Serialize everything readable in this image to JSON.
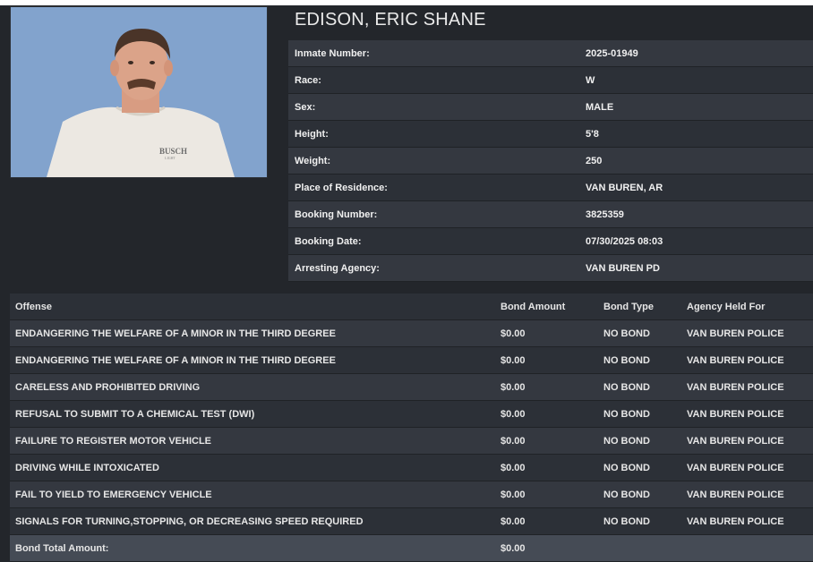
{
  "inmate": {
    "name": "EDISON, ERIC SHANE",
    "fields": [
      {
        "label": "Inmate Number:",
        "value": "2025-01949"
      },
      {
        "label": "Race:",
        "value": "W"
      },
      {
        "label": "Sex:",
        "value": "MALE"
      },
      {
        "label": "Height:",
        "value": "5'8"
      },
      {
        "label": "Weight:",
        "value": "250"
      },
      {
        "label": "Place of Residence:",
        "value": "VAN BUREN, AR"
      },
      {
        "label": "Booking Number:",
        "value": "3825359"
      },
      {
        "label": "Booking Date:",
        "value": "07/30/2025 08:03"
      },
      {
        "label": "Arresting Agency:",
        "value": "VAN BUREN PD"
      }
    ],
    "photo_shirt_text": "BUSCH",
    "photo_shirt_subtext": "LIGHT"
  },
  "charges": {
    "headers": {
      "offense": "Offense",
      "bond_amount": "Bond Amount",
      "bond_type": "Bond Type",
      "agency": "Agency Held For"
    },
    "rows": [
      {
        "offense": "ENDANGERING THE WELFARE OF A MINOR IN THE THIRD DEGREE",
        "bond_amount": "$0.00",
        "bond_type": "NO BOND",
        "agency": "VAN BUREN POLICE"
      },
      {
        "offense": "ENDANGERING THE WELFARE OF A MINOR IN THE THIRD DEGREE",
        "bond_amount": "$0.00",
        "bond_type": "NO BOND",
        "agency": "VAN BUREN POLICE"
      },
      {
        "offense": "CARELESS AND PROHIBITED DRIVING",
        "bond_amount": "$0.00",
        "bond_type": "NO BOND",
        "agency": "VAN BUREN POLICE"
      },
      {
        "offense": "REFUSAL TO SUBMIT TO A CHEMICAL TEST (DWI)",
        "bond_amount": "$0.00",
        "bond_type": "NO BOND",
        "agency": "VAN BUREN POLICE"
      },
      {
        "offense": "FAILURE TO REGISTER MOTOR VEHICLE",
        "bond_amount": "$0.00",
        "bond_type": "NO BOND",
        "agency": "VAN BUREN POLICE"
      },
      {
        "offense": "DRIVING WHILE INTOXICATED",
        "bond_amount": "$0.00",
        "bond_type": "NO BOND",
        "agency": "VAN BUREN POLICE"
      },
      {
        "offense": "FAIL TO YIELD TO EMERGENCY VEHICLE",
        "bond_amount": "$0.00",
        "bond_type": "NO BOND",
        "agency": "VAN BUREN POLICE"
      },
      {
        "offense": "SIGNALS FOR TURNING,STOPPING, OR DECREASING SPEED REQUIRED",
        "bond_amount": "$0.00",
        "bond_type": "NO BOND",
        "agency": "VAN BUREN POLICE"
      }
    ],
    "total_label": "Bond Total Amount:",
    "total_value": "$0.00"
  }
}
